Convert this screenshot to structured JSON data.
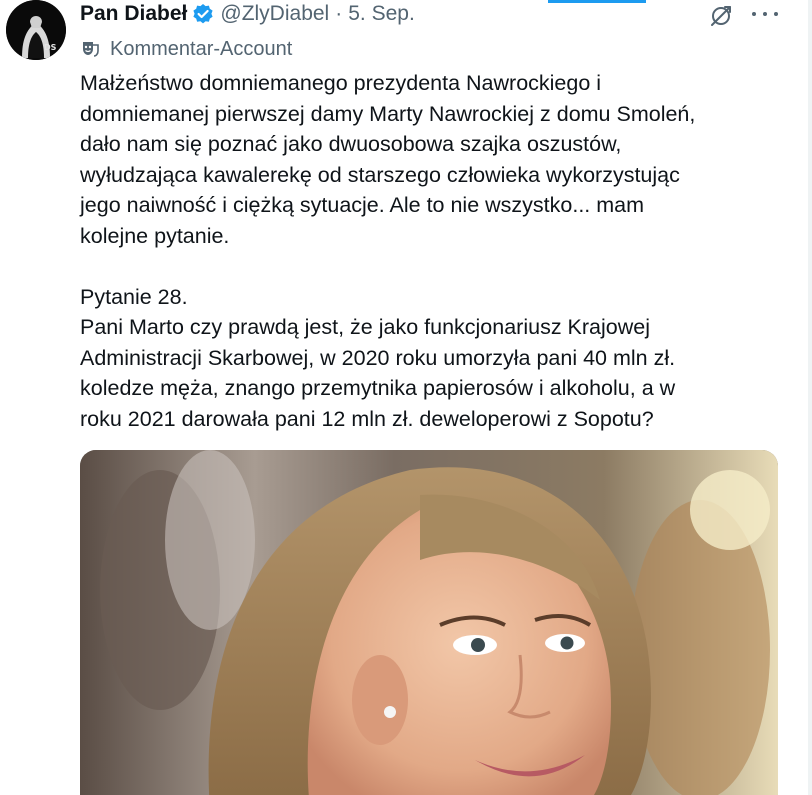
{
  "tweet": {
    "author_name": "Pan Diabeł",
    "handle": "@ZlyDiabel",
    "separator": "·",
    "date": "5. Sep.",
    "account_label": "Kommentar-Account",
    "avatar_text": "DS",
    "paragraph_1": "Małżeństwo domniemanego prezydenta Nawrockiego i\ndomniemanej pierwszej damy Marty Nawrockiej z domu Smoleń,\ndało nam się poznać jako dwuosobowa szajka oszustów,\nwyłudzająca kawalerekę od starszego człowieka wykorzystując\njego naiwność i ciężką sytuacje. Ale to nie wszystko... mam\nkolejne pytanie.",
    "paragraph_2": "Pytanie 28.\nPani Marto czy prawdą jest, że jako funkcjonariusz Krajowej\nAdministracji Skarbowej, w 2020 roku umorzyła pani 40 mln zł.\nkoledze męża, znango przemytnika papierosów i alkoholu, a w\nroku 2021 darowała pani 12 mln zł. deweloperowi z Sopotu?"
  },
  "icons": {
    "verified": "verified-badge-icon",
    "grok": "grok-icon",
    "more": "more-options-icon",
    "mask": "theater-mask-icon"
  },
  "colors": {
    "accent": "#1d9bf0",
    "secondary_text": "#536471",
    "primary_text": "#0f1419"
  }
}
